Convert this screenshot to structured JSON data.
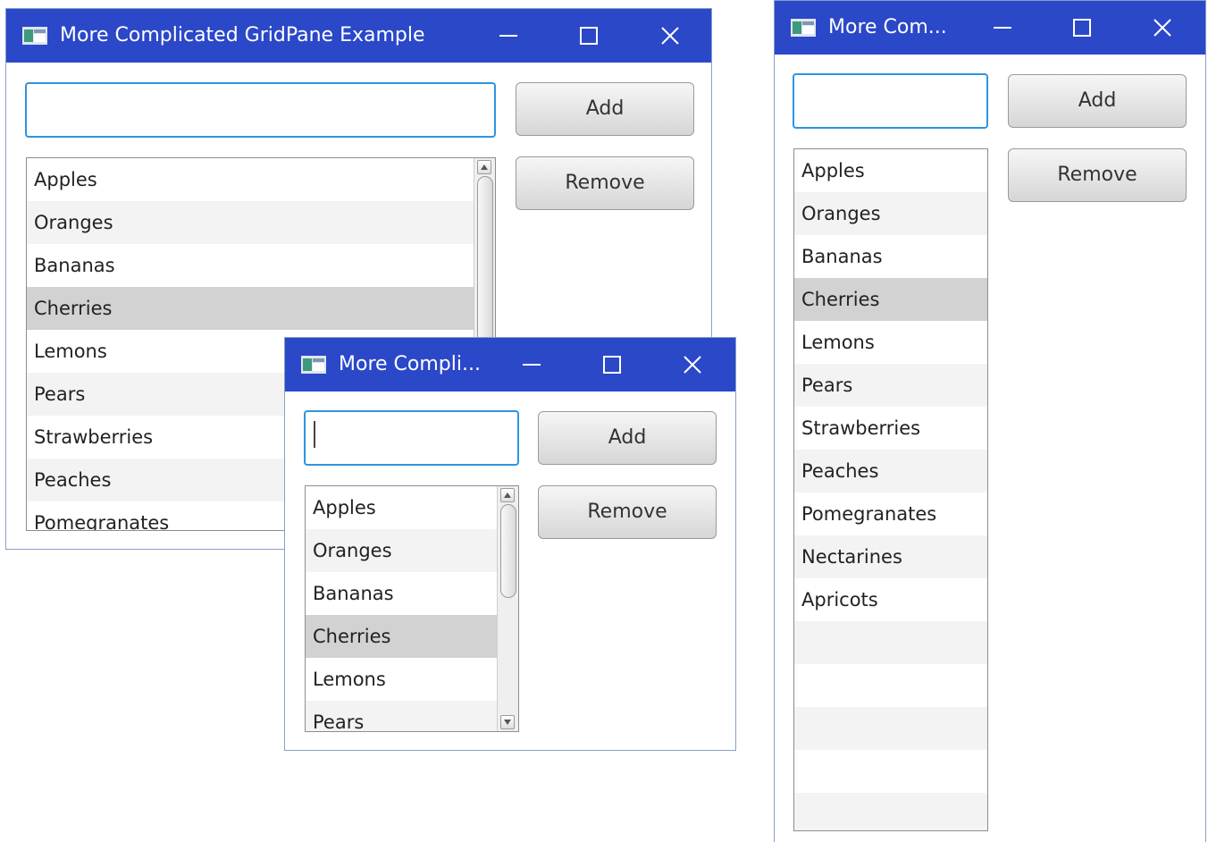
{
  "windows": {
    "first": {
      "title": "More Complicated GridPane Example",
      "input_value": "",
      "add_label": "Add",
      "remove_label": "Remove",
      "items": [
        "Apples",
        "Oranges",
        "Bananas",
        "Cherries",
        "Lemons",
        "Pears",
        "Strawberries",
        "Peaches",
        "Pomegranates"
      ]
    },
    "second": {
      "title": "More Compli...",
      "input_value": "",
      "add_label": "Add",
      "remove_label": "Remove",
      "items": [
        "Apples",
        "Oranges",
        "Bananas",
        "Cherries",
        "Lemons",
        "Pears"
      ]
    },
    "third": {
      "title": "More Com...",
      "input_value": "",
      "add_label": "Add",
      "remove_label": "Remove",
      "items": [
        "Apples",
        "Oranges",
        "Bananas",
        "Cherries",
        "Lemons",
        "Pears",
        "Strawberries",
        "Peaches",
        "Pomegranates",
        "Nectarines",
        "Apricots",
        "",
        "",
        "",
        "",
        "",
        ""
      ]
    }
  },
  "selected_item": "Cherries",
  "colors": {
    "title_bar": "#2b48c9",
    "focus_border": "#2f94e0",
    "selected_row": "#d2d2d2"
  },
  "icons": {
    "app": "java-app-icon",
    "minimize": "minimize-icon",
    "maximize": "maximize-icon",
    "close": "close-icon"
  }
}
